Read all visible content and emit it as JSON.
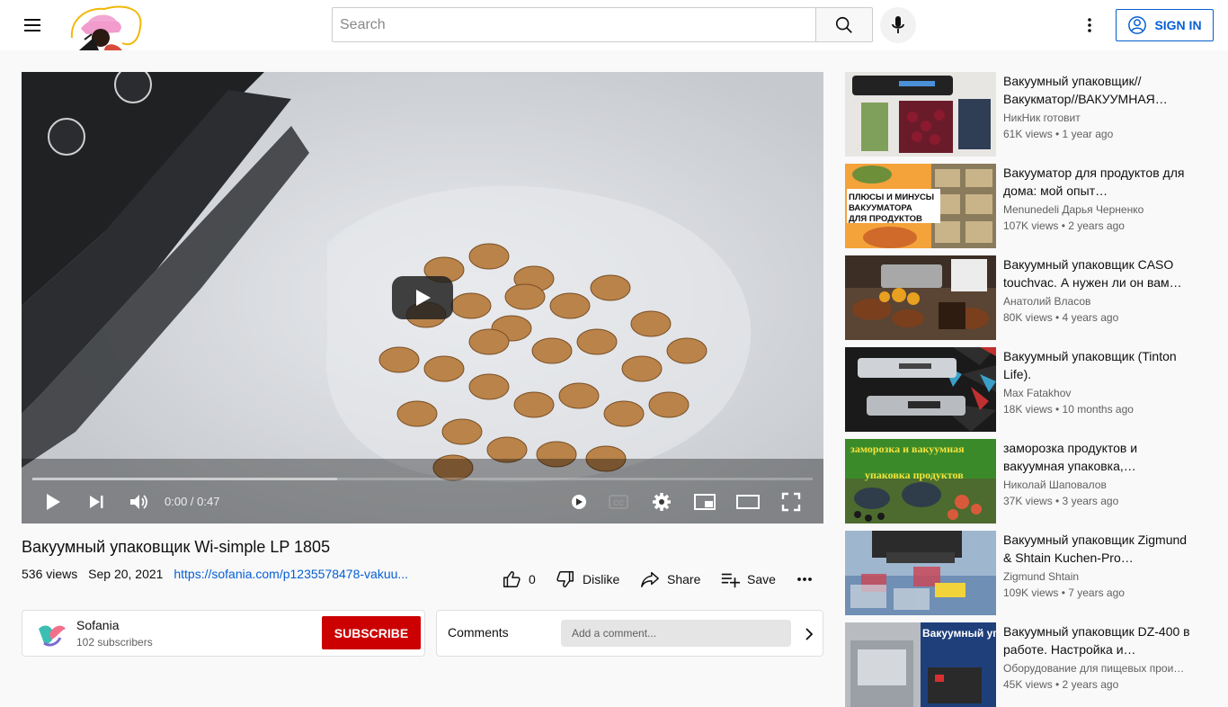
{
  "header": {
    "search_placeholder": "Search",
    "sign_in_label": "SIGN IN"
  },
  "player": {
    "time_display": "0:00 / 0:47",
    "progress_fraction": 0.39
  },
  "video": {
    "title": "Вакуумный упаковщик Wi-simple LP 1805",
    "views": "536 views",
    "date": "Sep 20, 2021",
    "link": "https://sofania.com/p1235578478-vakuu...",
    "likes": "0",
    "dislike_label": "Dislike",
    "share_label": "Share",
    "save_label": "Save"
  },
  "channel": {
    "name": "Sofania",
    "subscribers": "102 subscribers",
    "subscribe_label": "SUBSCRIBE"
  },
  "comments": {
    "label": "Comments",
    "placeholder": "Add a comment..."
  },
  "recommendations": [
    {
      "title": "Вакуумный упаковщик// Вакукматор//ВАКУУМНАЯ…",
      "channel": "НикНик готовит",
      "meta": "61K views • 1 year ago"
    },
    {
      "title": "Вакууматор для продуктов для дома: мой опыт…",
      "channel": "Menunedeli Дарья Черненко",
      "meta": "107K views • 2 years ago",
      "thumb_text": "ПЛЮСЫ И МИНУСЫ ВАКУУМАТОРА ДЛЯ ПРОДУКТОВ"
    },
    {
      "title": "Вакуумный упаковщик CASO touchvac. А нужен ли он вам…",
      "channel": "Анатолий Власов",
      "meta": "80K views • 4 years ago"
    },
    {
      "title": "Вакуумный упаковщик (Tinton Life).",
      "channel": "Max Fatakhov",
      "meta": "18K views • 10 months ago"
    },
    {
      "title": "заморозка продуктов и вакуумная упаковка,…",
      "channel": "Николай Шаповалов",
      "meta": "37K views • 3 years ago",
      "thumb_text_1": "заморозка и вакуумная",
      "thumb_text_2": "упаковка продуктов"
    },
    {
      "title": "Вакуумный упаковщик Zigmund & Shtain Kuchen-Pro…",
      "channel": "Zigmund Shtain",
      "meta": "109K views • 7 years ago"
    },
    {
      "title": "Вакуумный упаковщик DZ-400 в работе. Настройка и…",
      "channel": "Оборудование для пищевых прои…",
      "meta": "45K views • 2 years ago",
      "thumb_text": "Вакуумный упаковщик"
    }
  ],
  "colors": {
    "brand_blue": "#065fd4",
    "subscribe_red": "#cc0000"
  },
  "icons": [
    "menu-icon",
    "search-icon",
    "mic-icon",
    "more-vert-icon",
    "account-icon",
    "play-icon",
    "next-icon",
    "volume-icon",
    "autoplay-toggle-icon",
    "cc-icon",
    "settings-icon",
    "miniplayer-icon",
    "theater-icon",
    "fullscreen-icon",
    "thumb-up-icon",
    "thumb-down-icon",
    "share-icon",
    "save-playlist-icon",
    "chevron-right-icon"
  ]
}
